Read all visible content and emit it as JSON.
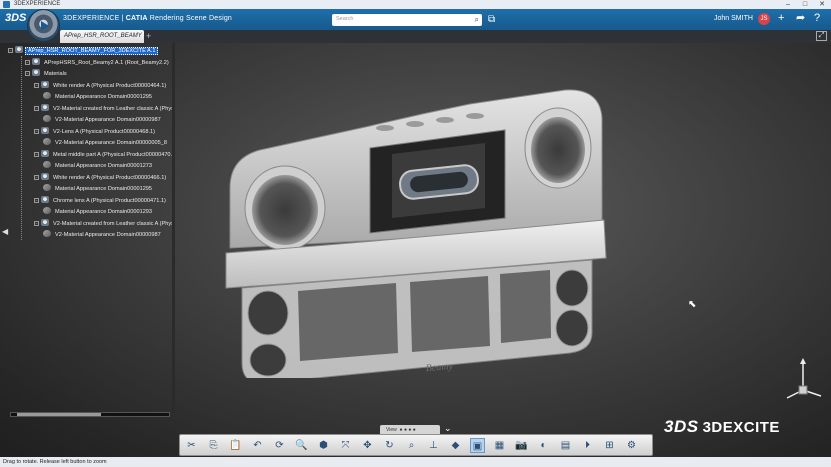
{
  "window": {
    "title": "3DEXPERIENCE",
    "controls": [
      "–",
      "□",
      "✕"
    ]
  },
  "header": {
    "brand_prefix": "3DEXPERIENCE | ",
    "brand_app": "CATIA",
    "brand_suffix": " Rendering Scene Design",
    "search_placeholder": "Search",
    "user_name": "John SMITH",
    "user_badge": "JS"
  },
  "tabs": [
    {
      "label": "APrep_HSR_ROOT_BEAMY"
    }
  ],
  "tree": {
    "items": [
      {
        "label": "APrep_HSR_ROOT_BEAMY_FOR_3DEXCITE A.1",
        "level": 0,
        "icon": "product-icon",
        "selected": true
      },
      {
        "label": "APrepHSRS_Root_Beamy2 A.1 (Root_Beamy2.2)",
        "level": 1,
        "icon": "product-icon"
      },
      {
        "label": "Materials",
        "level": 1,
        "icon": "folder-icon"
      },
      {
        "label": "White render A (Physical Product00000464.1)",
        "level": 2,
        "icon": "product-icon"
      },
      {
        "label": "Material Appearance Domain00001295",
        "level": 3,
        "icon": "material-icon"
      },
      {
        "label": "V2-Material created from Leather classic A (Physi",
        "level": 2,
        "icon": "product-icon"
      },
      {
        "label": "V2-Material Appearance Domain00000987",
        "level": 3,
        "icon": "material-icon"
      },
      {
        "label": "V2-Lens A (Physical Product00000468.1)",
        "level": 2,
        "icon": "product-icon"
      },
      {
        "label": "V2-Material Appearance Domain00000005_8",
        "level": 3,
        "icon": "material-icon"
      },
      {
        "label": "Metal middle part A (Physical Product00000470.",
        "level": 2,
        "icon": "product-icon"
      },
      {
        "label": "Material Appearance Domain00001273",
        "level": 3,
        "icon": "material-icon"
      },
      {
        "label": "White render A (Physical Product00000466.1)",
        "level": 2,
        "icon": "product-icon"
      },
      {
        "label": "Material Appearance Domain00001295",
        "level": 3,
        "icon": "material-icon"
      },
      {
        "label": "Chrome lens A (Physical Product00000471.1)",
        "level": 2,
        "icon": "product-icon"
      },
      {
        "label": "Material Appearance Domain00001293",
        "level": 3,
        "icon": "material-icon"
      },
      {
        "label": "V2-Material created from Leather classic A (Physi",
        "level": 2,
        "icon": "product-icon"
      },
      {
        "label": "V2-Material Appearance Domain00000987",
        "level": 3,
        "icon": "material-icon"
      }
    ]
  },
  "viewport": {
    "view_label": "View",
    "brand_mark": "3DEXCITE",
    "model_engraving": "Beamy"
  },
  "toolbar": {
    "tools": [
      {
        "name": "cut-icon",
        "glyph": "✂"
      },
      {
        "name": "copy-icon",
        "glyph": "⎘"
      },
      {
        "name": "paste-icon",
        "glyph": "📋"
      },
      {
        "name": "undo-icon",
        "glyph": "↶"
      },
      {
        "name": "update-icon",
        "glyph": "⟳"
      },
      {
        "name": "zoom-icon",
        "glyph": "🔍"
      },
      {
        "name": "iso-view-icon",
        "glyph": "⬢"
      },
      {
        "name": "fit-all-icon",
        "glyph": "⤧"
      },
      {
        "name": "pan-icon",
        "glyph": "✥"
      },
      {
        "name": "rotate-icon",
        "glyph": "↻"
      },
      {
        "name": "zoom-area-icon",
        "glyph": "⌕"
      },
      {
        "name": "normal-view-icon",
        "glyph": "⊥"
      },
      {
        "name": "shading-icon",
        "glyph": "◆"
      },
      {
        "name": "render-icon",
        "glyph": "▣"
      },
      {
        "name": "render-region-icon",
        "glyph": "▦"
      },
      {
        "name": "capture-icon",
        "glyph": "📷"
      },
      {
        "name": "environment-icon",
        "glyph": "◐"
      },
      {
        "name": "layout-icon",
        "glyph": "▤"
      },
      {
        "name": "sequence-icon",
        "glyph": "⏵"
      },
      {
        "name": "structure-icon",
        "glyph": "⊞"
      },
      {
        "name": "settings-icon",
        "glyph": "⚙"
      }
    ]
  },
  "status": {
    "text": "Drag to rotate. Release left button to zoom"
  }
}
